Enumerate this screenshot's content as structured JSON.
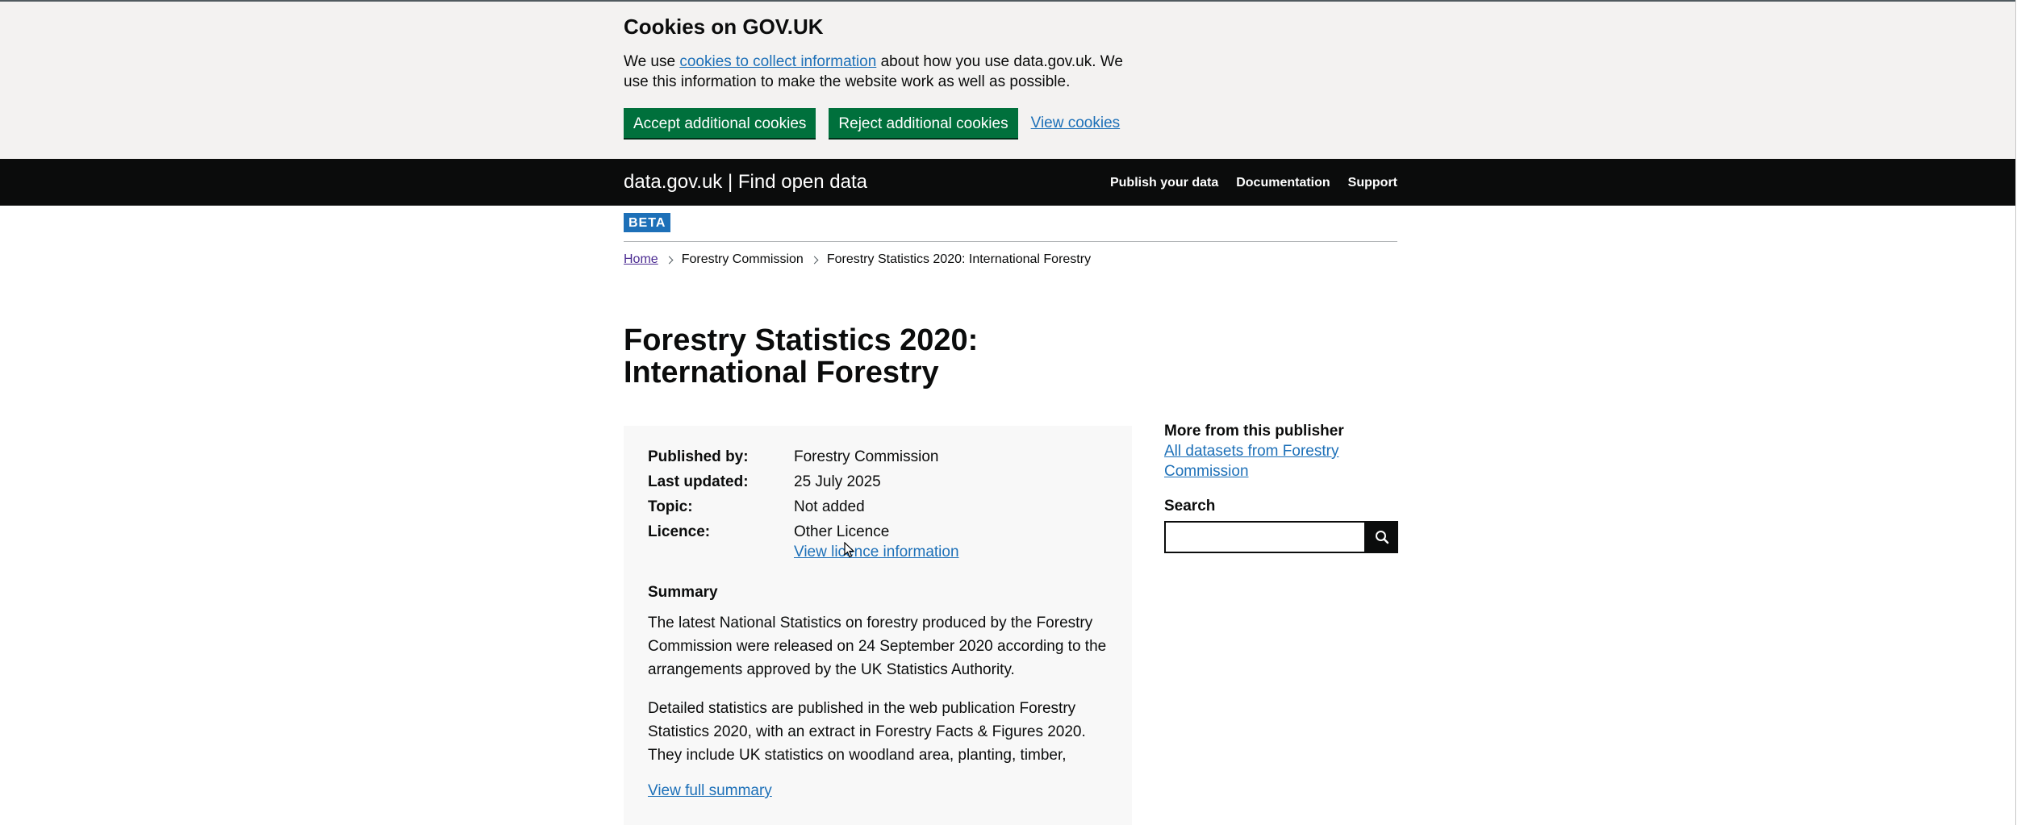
{
  "cookie_banner": {
    "title": "Cookies on GOV.UK",
    "text_before": "We use ",
    "link_text": "cookies to collect information",
    "text_after": " about how you use data.gov.uk. We use this information to make the website work as well as possible.",
    "accept_label": "Accept additional cookies",
    "reject_label": "Reject additional cookies",
    "view_label": "View cookies"
  },
  "header": {
    "title": "data.gov.uk | Find open data",
    "nav": [
      "Publish your data",
      "Documentation",
      "Support"
    ]
  },
  "beta_tag": "BETA",
  "breadcrumb": {
    "items": [
      "Home",
      "Forestry Commission",
      "Forestry Statistics 2020: International Forestry"
    ]
  },
  "page_title": "Forestry Statistics 2020: International Forestry",
  "meta": {
    "rows": [
      {
        "key": "Published by:",
        "value": "Forestry Commission"
      },
      {
        "key": "Last updated:",
        "value": "25 July 2025"
      },
      {
        "key": "Topic:",
        "value": "Not added"
      },
      {
        "key": "Licence:",
        "value": "Other Licence"
      }
    ],
    "licence_link": "View licence information",
    "summary_heading": "Summary",
    "summary_p1": "The latest National Statistics on forestry produced by the Forestry Commission were released on 24 September 2020 according to the arrangements approved by the UK Statistics Authority.",
    "summary_p2": "Detailed statistics are published in the web publication Forestry Statistics 2020, with an extract in Forestry Facts & Figures 2020. They include UK statistics on woodland area, planting, timber,",
    "view_full_summary": "View full summary"
  },
  "sidebar": {
    "title": "More from this publisher",
    "publisher_link": "All datasets from Forestry Commission",
    "search_label": "Search",
    "search_placeholder": ""
  },
  "colors": {
    "link": "#1d70b8",
    "green_button": "#00703c",
    "header_bg": "#0b0c0c",
    "banner_bg": "#f3f2f1",
    "beta_bg": "#1d70b8"
  },
  "icons": {
    "search": "search-icon",
    "breadcrumb_separator": "chevron-right-icon"
  }
}
